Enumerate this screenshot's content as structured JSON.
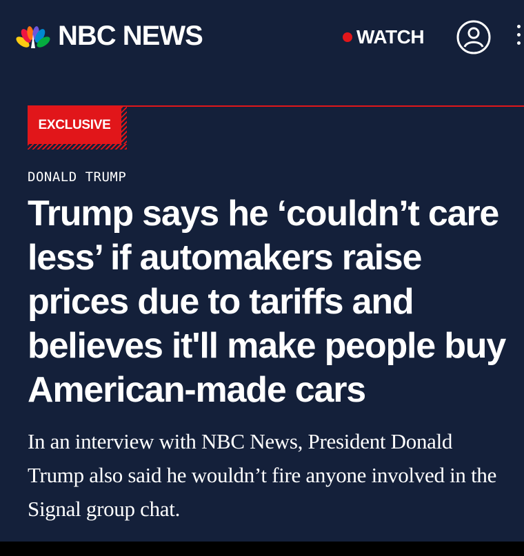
{
  "header": {
    "brand": "NBC NEWS",
    "logo_icon": "nbc-peacock-icon",
    "watch_label": "WATCH",
    "live_color": "#e1161a",
    "account_icon": "user-account-icon",
    "menu_icon": "more-vertical-icon"
  },
  "article": {
    "badge": "EXCLUSIVE",
    "section": "DONALD TRUMP",
    "headline": "Trump says he ‘couldn’t care less’ if automakers raise prices due to tariffs and believes it'll make people buy American-made cars",
    "dek_lines": [
      "In an interview with NBC News, President Donald",
      "Trump also said he wouldn’t fire anyone involved in the",
      "Signal group chat."
    ]
  },
  "colors": {
    "background": "#14203a",
    "accent": "#e1161a",
    "text": "#ffffff"
  }
}
